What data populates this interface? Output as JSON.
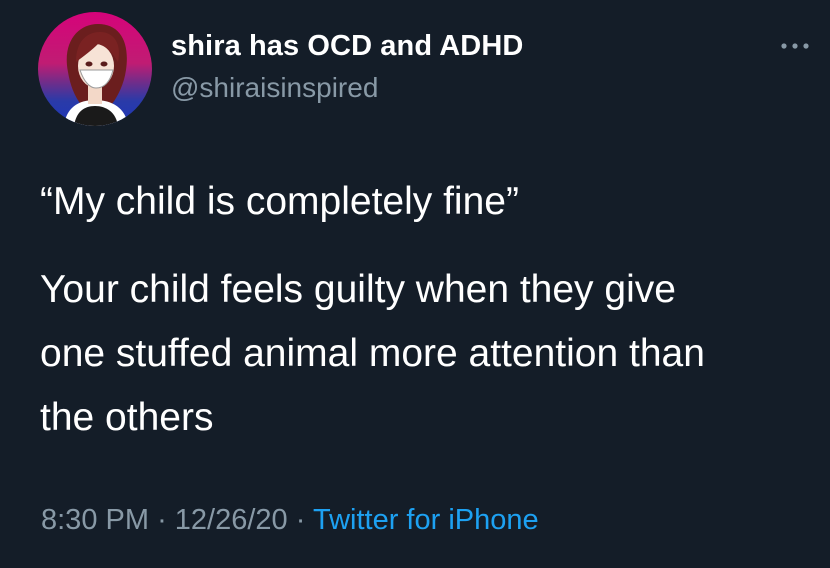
{
  "tweet": {
    "display_name": "shira has OCD and ADHD",
    "handle": "@shiraisinspired",
    "text_first": "“My child is completely fine”",
    "text_body_lines": [
      "Your child feels guilty when they give",
      "one stuffed animal more attention than",
      "the others"
    ],
    "time": "8:30 PM",
    "separator": "·",
    "date": "12/26/20",
    "source": "Twitter for iPhone"
  },
  "icons": {
    "more": "more-horizontal-icon",
    "avatar": "avatar-illustration"
  },
  "colors": {
    "background": "#141d28",
    "text": "#ffffff",
    "secondary": "#8899a6",
    "link": "#1da1f2"
  }
}
